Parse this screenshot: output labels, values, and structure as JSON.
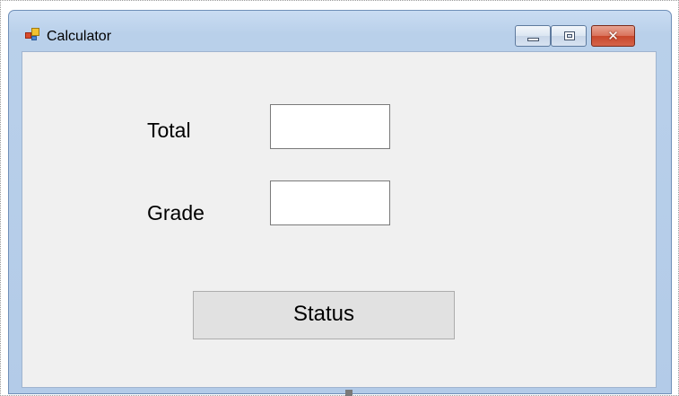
{
  "window": {
    "title": "Calculator",
    "icon": "winforms-app-icon",
    "controls": {
      "minimize_icon": "minimize-icon",
      "maximize_icon": "maximize-icon",
      "close_icon": "close-icon",
      "close_glyph": "✕"
    }
  },
  "form": {
    "total_label": "Total",
    "total_value": "",
    "grade_label": "Grade",
    "grade_value": "",
    "status_button_label": "Status"
  },
  "colors": {
    "client_background": "#f0f0f0",
    "close_button": "#c8472c",
    "title_bar": "#b9d0ea"
  }
}
